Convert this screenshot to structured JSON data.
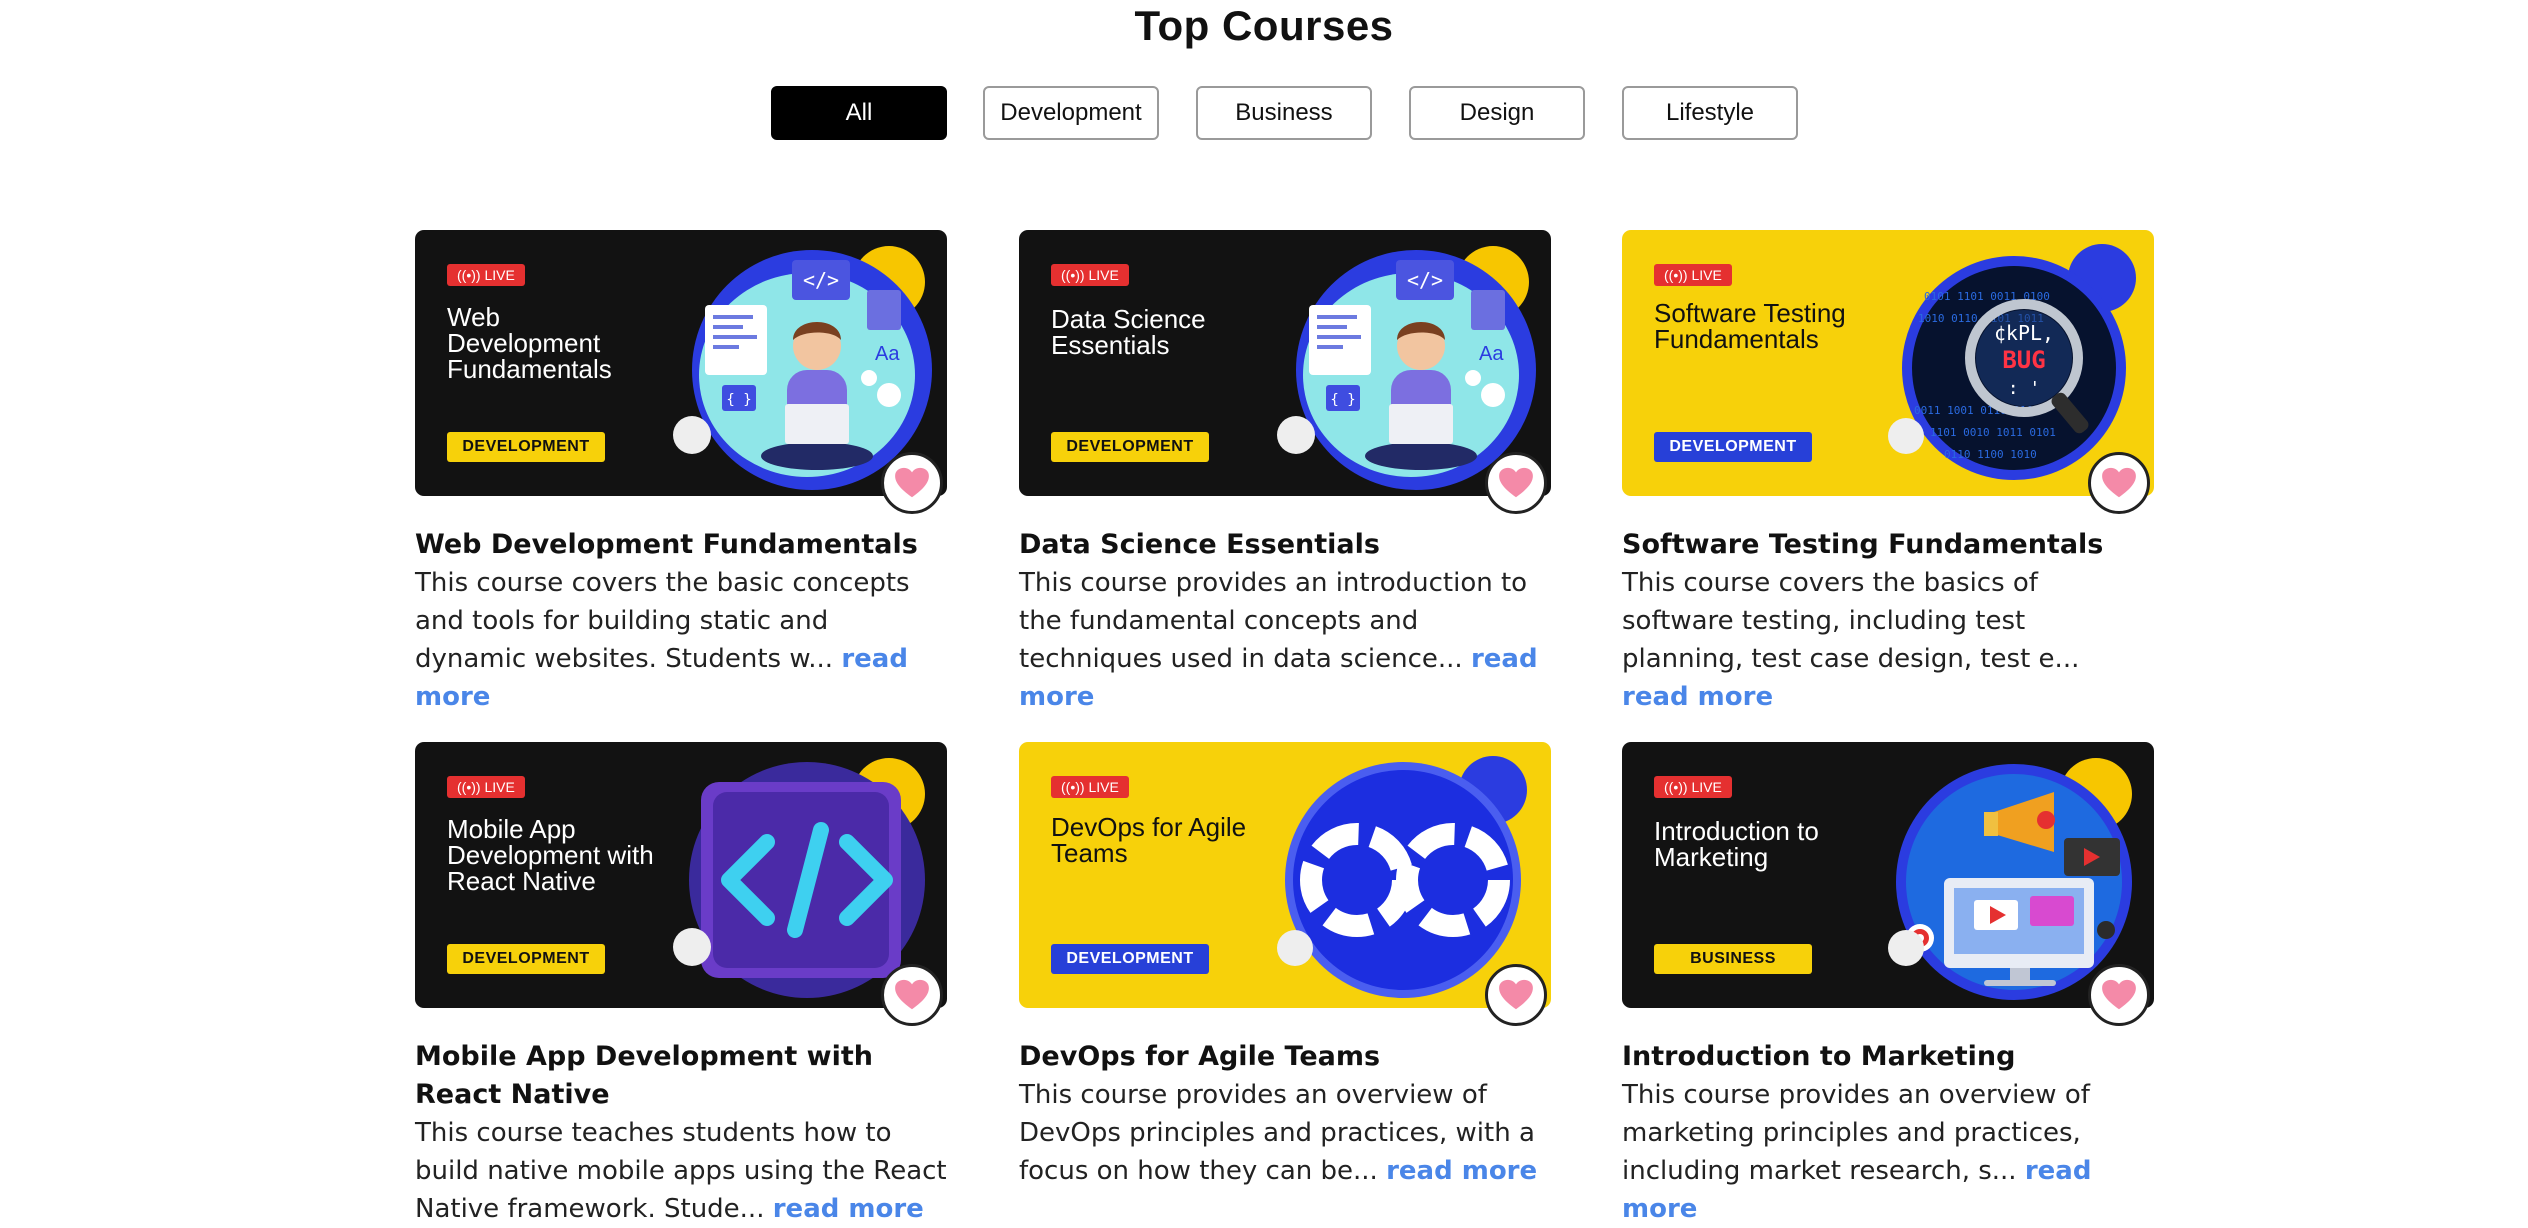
{
  "page_title": "Top Courses",
  "filters": [
    "All",
    "Development",
    "Business",
    "Design",
    "Lifestyle"
  ],
  "active_filter": "All",
  "colors": {
    "accent_link": "#4a86e8",
    "live_badge": "#e53030",
    "brand_yellow": "#f7d10a",
    "brand_blue": "#2740d8"
  },
  "courses": [
    {
      "banner_theme": "dark",
      "art": "developer-illustration",
      "live_label": "LIVE",
      "banner_title": "Web Development Fundamentals",
      "tag": "DEVELOPMENT",
      "title": "Web Development Fundamentals",
      "desc": "This course covers the basic concepts and tools for building static and dynamic websites. Students w...",
      "more": "read more"
    },
    {
      "banner_theme": "dark",
      "art": "developer-illustration",
      "live_label": "LIVE",
      "banner_title": "Data Science Essentials",
      "tag": "DEVELOPMENT",
      "title": "Data Science Essentials",
      "desc": "This course provides an introduction to the fundamental concepts and techniques used in data science...",
      "more": "read more"
    },
    {
      "banner_theme": "yellow",
      "art": "bug-magnifier",
      "live_label": "LIVE",
      "banner_title": "Software Testing Fundamentals",
      "tag": "DEVELOPMENT",
      "title": "Software Testing Fundamentals",
      "desc": "This course covers the basics of software testing, including test planning, test case design, test e...",
      "more": "read more"
    },
    {
      "banner_theme": "dark",
      "art": "code-brackets",
      "live_label": "LIVE",
      "banner_title": "Mobile App Development with React Native",
      "tag": "DEVELOPMENT",
      "title": "Mobile App Development with React Native",
      "desc": "This course teaches students how to build native mobile apps using the React Native framework. Stude...",
      "more": "read more"
    },
    {
      "banner_theme": "yellow",
      "art": "infinity-loop",
      "live_label": "LIVE",
      "banner_title": "DevOps for Agile Teams",
      "tag": "DEVELOPMENT",
      "title": "DevOps for Agile Teams",
      "desc": "This course provides an overview of DevOps principles and practices, with a focus on how they can be...",
      "more": "read more"
    },
    {
      "banner_theme": "dark",
      "art": "marketing-megaphone",
      "live_label": "LIVE",
      "banner_title": "Introduction to Marketing",
      "tag": "BUSINESS",
      "title": "Introduction to Marketing",
      "desc": "This course provides an overview of marketing principles and practices, including market research, s...",
      "more": "read more"
    }
  ]
}
